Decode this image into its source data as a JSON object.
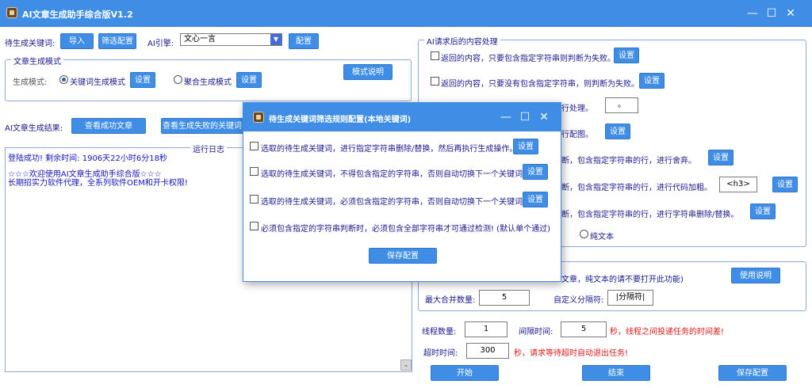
{
  "window": {
    "title": "AI文章生成助手综合版V1.2",
    "minimize": "—",
    "maximize": "☐",
    "close": "✕"
  },
  "top": {
    "keyword_label": "待生成关键词:",
    "import_btn": "导入",
    "filter_btn": "筛选配置",
    "engine_label": "AI引擎:",
    "engine_value": "文心一言",
    "config_btn": "配置"
  },
  "mode_group": {
    "title": "文章生成模式",
    "mode_label": "生成模式:",
    "option_keyword": "关键词生成模式",
    "option_keyword_selected": true,
    "setting_btn_1": "设置",
    "option_aggregate": "聚合生成模式",
    "setting_btn_2": "设置",
    "mode_help_btn": "模式说明"
  },
  "results": {
    "label": "AI文章生成结果:",
    "view_success_btn": "查看成功文章",
    "view_fail_btn": "查看生成失败的关键词"
  },
  "log": {
    "title": "运行日志",
    "lines": [
      "登陆成功! 剩余时间: 1906天22小时6分18秒",
      "☆☆☆欢迎使用AI文章生成助手综合版☆☆☆",
      "长期招实力软件代理，全系列软件OEM和开卡权限!"
    ],
    "scroll_glyph": "⌄"
  },
  "post_group": {
    "title": "AI请求后的内容处理",
    "rows": [
      {
        "text": "返回的内容，只要包含指定字符串则判断为失败。",
        "btn": "设置"
      },
      {
        "text": "返回的内容，只要没有包含指定字符串，则判断为失败。",
        "btn": "设置"
      },
      {
        "text": "行处理。",
        "value": "。"
      },
      {
        "text": "行配图。",
        "btn": "设置"
      },
      {
        "text": "断，包含指定字符串的行，进行舍弃。",
        "btn": "设置"
      },
      {
        "text": "断，包含指定字符串的行，进行代码加粗。",
        "value": "<h3>",
        "btn": "设置"
      },
      {
        "text": "断，包含指定字符串的行，进行字符串删除/替换。",
        "btn": "设置"
      }
    ],
    "plain_text_option": "纯文本"
  },
  "merge_group": {
    "note": "文章，纯文本的请不要打开此功能)",
    "help_btn": "使用说明",
    "max_merge_label": "最大合并数量:",
    "max_merge_value": "5",
    "separator_label": "自定义分隔符:",
    "separator_value": "|分隔符|"
  },
  "thread": {
    "count_label": "线程数量:",
    "count_value": "1",
    "interval_label": "间隔时间:",
    "interval_value": "5",
    "interval_note": "秒，线程之间投递任务的时间差!",
    "timeout_label": "超时时间:",
    "timeout_value": "300",
    "timeout_note": "秒，请求等待超时自动退出任务!"
  },
  "bottom": {
    "start_btn": "开始",
    "stop_btn": "结束",
    "save_btn": "保存配置"
  },
  "dialog": {
    "title": "待生成关键词筛选规则配置(本地关键词)",
    "minimize": "—",
    "maximize": "☐",
    "close": "✕",
    "rules": [
      {
        "text": "选取的待生成关键词，进行指定字符串删除/替换，然后再执行生成操作。",
        "btn": "设置"
      },
      {
        "text": "选取的待生成关键词，不得包含指定的字符串，否则自动切换下一个关键词。",
        "btn": "设置"
      },
      {
        "text": "选取的待生成关键词，必须包含指定的字符串，否则自动切换下一个关键词。",
        "btn": "设置"
      },
      {
        "text": "必须包含指定的字符串判断时，必须包含全部字符串才可通过检测! (默认单个通过)"
      }
    ],
    "save_btn": "保存配置"
  }
}
